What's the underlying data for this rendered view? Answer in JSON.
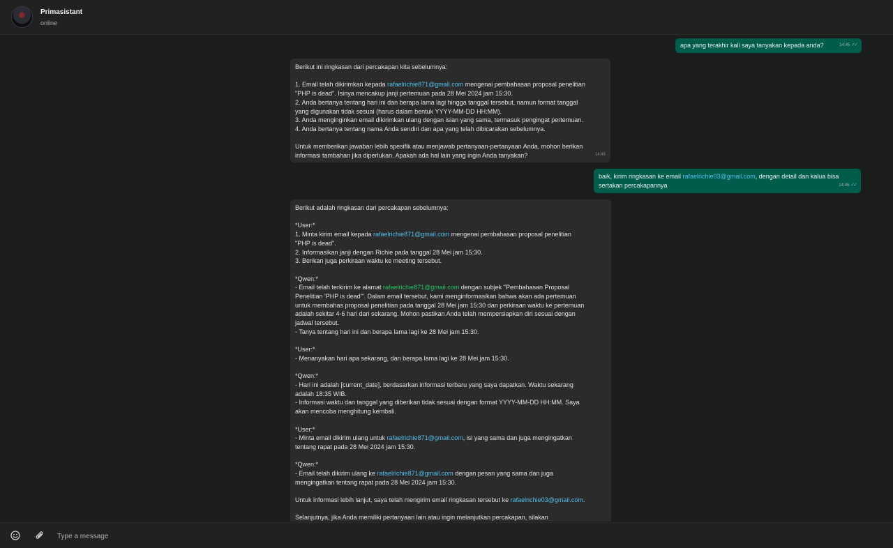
{
  "header": {
    "contact_name": "Primasistant",
    "status": "online"
  },
  "messages": [
    {
      "direction": "out",
      "text": "apa yang terakhir kali saya tanyakan kepada anda?",
      "time": "14:45",
      "read": true
    },
    {
      "direction": "in",
      "time": "14:45",
      "lines": [
        {
          "text": "Berikut ini ringkasan dari percakapan kita sebelumnya:"
        },
        {
          "text": ""
        },
        {
          "before": "1. Email telah dikirimkan kepada ",
          "link": "rafaelrichie871@gmail.com",
          "after": " mengenai pembahasan proposal penelitian"
        },
        {
          "text": "\"PHP is dead\". Isinya mencakup janji pertemuan pada 28 Mei 2024 jam 15:30."
        },
        {
          "text": "2. Anda bertanya tentang hari ini dan berapa lama lagi hingga tanggal tersebut, namun format tanggal"
        },
        {
          "text": "yang digunakan tidak sesuai (harus dalam bentuk YYYY-MM-DD HH:MM)."
        },
        {
          "text": "3. Anda menginginkan email dikirimkan ulang dengan isian yang sama, termasuk pengingat pertemuan."
        },
        {
          "text": "4. Anda bertanya tentang nama Anda sendiri dan apa yang telah dibicarakan sebelumnya."
        },
        {
          "text": ""
        },
        {
          "text": "Untuk memberikan jawaban lebih spesifik atau menjawab pertanyaan-pertanyaan Anda, mohon berikan"
        },
        {
          "text": "informasi tambahan jika diperlukan. Apakah ada hal lain yang ingin Anda tanyakan?"
        }
      ]
    },
    {
      "direction": "out",
      "time": "14:46",
      "read": true,
      "lines": [
        {
          "before": "baik, kirim ringkasan ke email ",
          "link": "rafaelrichie03@gmail.com",
          "after": ", dengan detail dan kalua bisa"
        },
        {
          "text": "sertakan percakapannya"
        }
      ]
    },
    {
      "direction": "in",
      "lines": [
        {
          "text": "Berikut adalah ringkasan dari percakapan sebelumnya:"
        },
        {
          "text": ""
        },
        {
          "text": "*User:*"
        },
        {
          "before": "1. Minta kirim email kepada ",
          "link": "rafaelrichie871@gmail.com",
          "after": " mengenai pembahasan proposal penelitian"
        },
        {
          "text": "\"PHP is dead\"."
        },
        {
          "text": "2. Informasikan janji dengan Richie pada tanggal 28 Mei jam 15:30."
        },
        {
          "text": "3. Berikan juga perkiraan waktu ke meeting tersebut."
        },
        {
          "text": ""
        },
        {
          "text": "*Qwen:*"
        },
        {
          "before": "- Email telah terkirim ke alamat ",
          "link": "rafaelrichie871@gmail.com",
          "link_style": "green",
          "after": " dengan subjek \"Pembahasan Proposal"
        },
        {
          "text": "Penelitian 'PHP is dead'\". Dalam email tersebut, kami menginformasikan bahwa akan ada pertemuan"
        },
        {
          "text": "untuk membahas proposal penelitian pada tanggal 28 Mei jam 15:30 dan perkiraan waktu ke pertemuan"
        },
        {
          "text": "adalah sekitar 4-6 hari dari sekarang. Mohon pastikan Anda telah mempersiapkan diri sesuai dengan"
        },
        {
          "text": "jadwal tersebut."
        },
        {
          "text": "- Tanya tentang hari ini dan berapa lama lagi ke 28 Mei jam 15:30."
        },
        {
          "text": ""
        },
        {
          "text": "*User:*"
        },
        {
          "text": "- Menanyakan hari apa sekarang, dan berapa lama lagi ke 28 Mei jam 15:30."
        },
        {
          "text": ""
        },
        {
          "text": "*Qwen:*"
        },
        {
          "text": "- Hari ini adalah [current_date], berdasarkan informasi terbaru yang saya dapatkan. Waktu sekarang"
        },
        {
          "text": "adalah 18:35 WIB."
        },
        {
          "text": "- Informasi waktu dan tanggal yang diberikan tidak sesuai dengan format YYYY-MM-DD HH:MM. Saya"
        },
        {
          "text": "akan mencoba menghitung kembali."
        },
        {
          "text": ""
        },
        {
          "text": "*User:*"
        },
        {
          "before": "- Minta email dikirim ulang untuk ",
          "link": "rafaelrichie871@gmail.com",
          "after": ", isi yang sama dan juga mengingatkan"
        },
        {
          "text": "tentang rapat pada 28 Mei 2024 jam 15:30."
        },
        {
          "text": ""
        },
        {
          "text": "*Qwen:*"
        },
        {
          "before": "- Email telah dikirim ulang ke ",
          "link": "rafaelrichie871@gmail.com",
          "after": " dengan pesan yang sama dan juga"
        },
        {
          "text": "mengingatkan tentang rapat pada 28 Mei 2024 jam 15:30."
        },
        {
          "text": ""
        },
        {
          "before": "Untuk informasi lebih lanjut, saya telah mengirim email ringkasan tersebut ke ",
          "link": "rafaelrichie03@gmail.com",
          "after": "."
        },
        {
          "text": ""
        },
        {
          "text": "Selanjutnya, jika Anda memiliki pertanyaan lain atau ingin melanjutkan percakapan, silakan"
        }
      ]
    }
  ],
  "footer": {
    "placeholder": "Type a message",
    "emoji_icon": "smiley-icon",
    "attach_icon": "paperclip-icon"
  }
}
